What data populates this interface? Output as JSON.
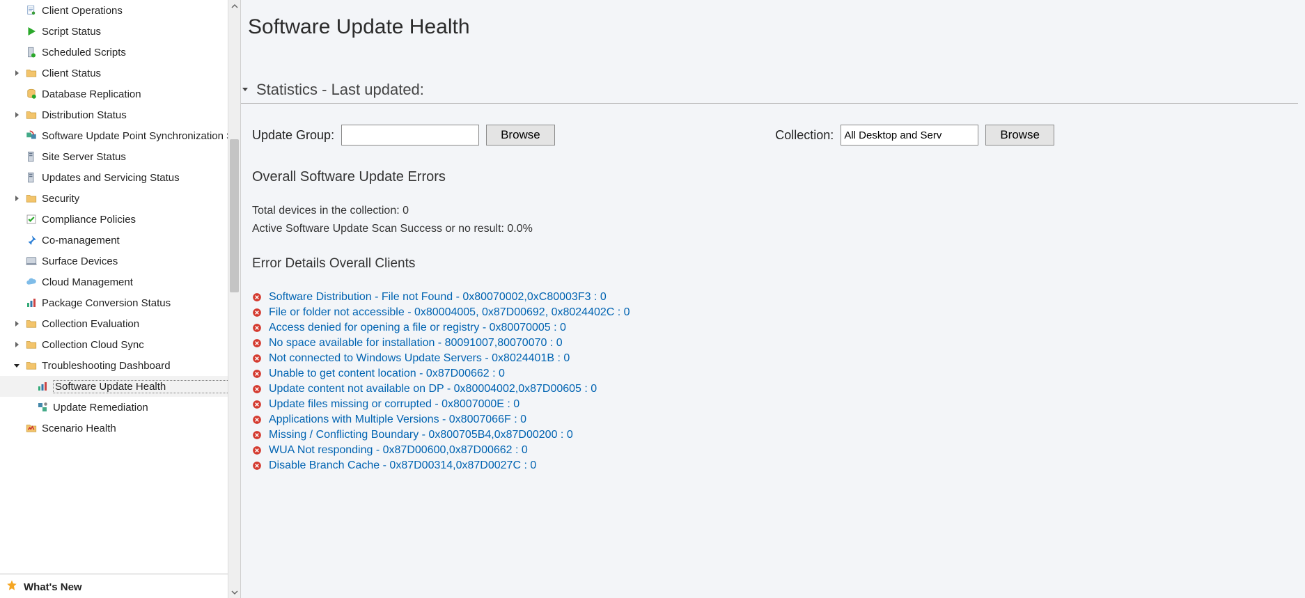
{
  "page": {
    "title": "Software Update Health",
    "section_title": "Statistics - Last updated:"
  },
  "filters": {
    "update_group_label": "Update Group:",
    "update_group_value": "",
    "update_group_browse": "Browse",
    "collection_label": "Collection:",
    "collection_value": "All Desktop and Serv",
    "collection_browse": "Browse"
  },
  "overall": {
    "heading": "Overall Software Update Errors",
    "total_devices": "Total devices in the collection: 0",
    "scan_success": "Active Software Update Scan Success or no result: 0.0%"
  },
  "details": {
    "heading": "Error Details Overall Clients",
    "errors": [
      "Software Distribution - File not Found - 0x80070002,0xC80003F3 : 0",
      "File or folder not accessible - 0x80004005, 0x87D00692, 0x8024402C : 0",
      "Access denied for opening a file or registry - 0x80070005 : 0",
      "No space available for installation - 80091007,80070070 : 0",
      "Not connected to Windows Update Servers - 0x8024401B  : 0",
      "Unable to get content location - 0x87D00662  : 0",
      "Update content not available on DP - 0x80004002,0x87D00605 : 0",
      "Update files missing or corrupted - 0x8007000E : 0",
      "Applications with Multiple Versions - 0x8007066F : 0",
      "Missing / Conflicting Boundary - 0x800705B4,0x87D00200 : 0",
      "WUA Not responding - 0x87D00600,0x87D00662 : 0",
      "Disable Branch Cache - 0x87D00314,0x87D0027C : 0"
    ]
  },
  "sidebar": {
    "items": [
      {
        "label": "Client Operations",
        "icon": "doc",
        "indent": 1,
        "exp": ""
      },
      {
        "label": "Script Status",
        "icon": "play",
        "indent": 1,
        "exp": ""
      },
      {
        "label": "Scheduled Scripts",
        "icon": "server-green",
        "indent": 1,
        "exp": ""
      },
      {
        "label": "Client Status",
        "icon": "folder",
        "indent": 1,
        "exp": "right"
      },
      {
        "label": "Database Replication",
        "icon": "db",
        "indent": 1,
        "exp": ""
      },
      {
        "label": "Distribution Status",
        "icon": "folder",
        "indent": 1,
        "exp": "right"
      },
      {
        "label": "Software Update Point Synchronization Sta",
        "icon": "sync",
        "indent": 1,
        "exp": ""
      },
      {
        "label": "Site Server Status",
        "icon": "server",
        "indent": 1,
        "exp": ""
      },
      {
        "label": "Updates and Servicing Status",
        "icon": "server",
        "indent": 1,
        "exp": ""
      },
      {
        "label": "Security",
        "icon": "folder",
        "indent": 1,
        "exp": "right"
      },
      {
        "label": "Compliance Policies",
        "icon": "check",
        "indent": 1,
        "exp": ""
      },
      {
        "label": "Co-management",
        "icon": "pin",
        "indent": 1,
        "exp": ""
      },
      {
        "label": "Surface Devices",
        "icon": "surface",
        "indent": 1,
        "exp": ""
      },
      {
        "label": "Cloud Management",
        "icon": "cloud",
        "indent": 1,
        "exp": ""
      },
      {
        "label": "Package Conversion Status",
        "icon": "chart",
        "indent": 1,
        "exp": ""
      },
      {
        "label": "Collection Evaluation",
        "icon": "folder",
        "indent": 1,
        "exp": "right"
      },
      {
        "label": "Collection Cloud Sync",
        "icon": "folder",
        "indent": 1,
        "exp": "right"
      },
      {
        "label": "Troubleshooting Dashboard",
        "icon": "folder",
        "indent": 1,
        "exp": "down"
      },
      {
        "label": "Software Update Health",
        "icon": "chart",
        "indent": 2,
        "exp": "",
        "selected": true
      },
      {
        "label": "Update Remediation",
        "icon": "gear",
        "indent": 2,
        "exp": ""
      },
      {
        "label": "Scenario Health",
        "icon": "health",
        "indent": 1,
        "exp": ""
      }
    ],
    "whats_new": "What's New"
  }
}
